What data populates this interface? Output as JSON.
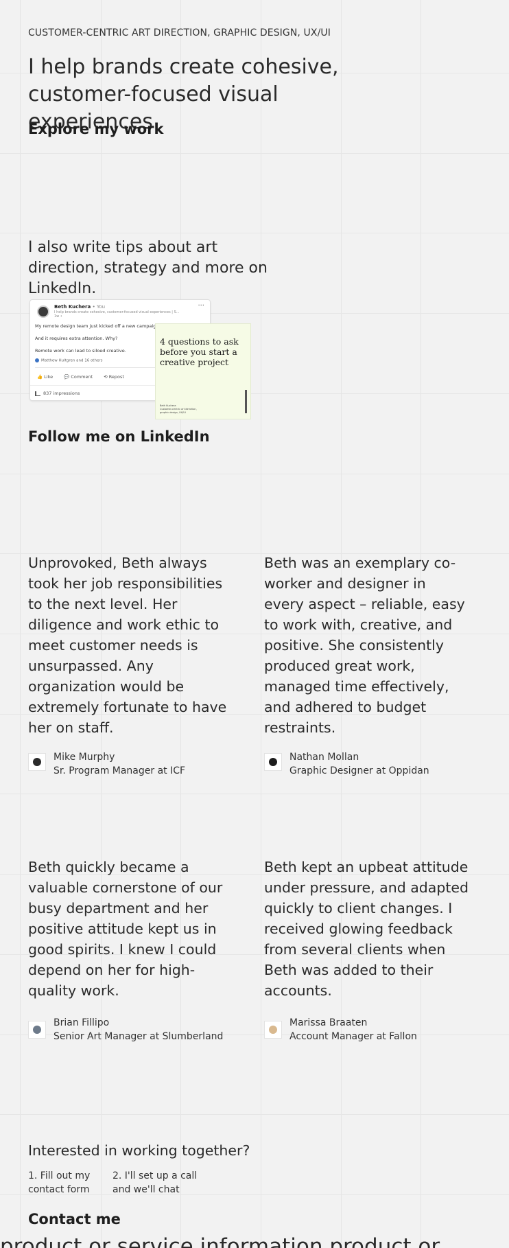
{
  "hero": {
    "eyebrow": "CUSTOMER-CENTRIC ART DIRECTION, GRAPHIC DESIGN, UX/UI",
    "headline": "I help brands create cohesive, customer-focused visual experiences",
    "explore_link": "Explore my work"
  },
  "linkedin_section": {
    "intro": "I also write tips about art direction, strategy and more on LinkedIn.",
    "post": {
      "author": "Beth Kuchera",
      "you_label": "• You",
      "meta": "I help brands create cohesive, customer-focused visual experiences | S...",
      "time": "1w • ",
      "line1": "My remote design team just kicked off a new campaign!",
      "line2": "And it requires extra attention. Why?",
      "line3": "Remote work can lead to siloed creative.",
      "reactions": "Matthew Hultgren and 16 others",
      "actions": [
        "Like",
        "Comment",
        "Repost"
      ],
      "impressions": "837 impressions",
      "more": "···"
    },
    "poster": {
      "title": "4 questions to ask before you start a creative project",
      "footer": "Beth Kuchera\nCustomer-centric art direction,\ngraphic design, UX/UI"
    },
    "follow_link": "Follow me on LinkedIn"
  },
  "testimonials": [
    {
      "quote": "Unprovoked, Beth always took her job responsibilities to the next level. Her diligence and work ethic to meet customer needs is unsurpassed. Any organization would be extremely fortunate to have her on staff.",
      "name": "Mike Murphy",
      "title": "Sr. Program Manager at ICF"
    },
    {
      "quote": "Beth was an exemplary co-worker and designer in every aspect – reliable, easy to work with, creative, and positive. She consistently produced great work, managed time effectively, and adhered to budget restraints.",
      "name": "Nathan Mollan",
      "title": "Graphic Designer at Oppidan"
    },
    {
      "quote": "Beth quickly became a valuable cornerstone of our busy department and her positive attitude kept us in good spirits. I knew I could depend on her for high-quality work.",
      "name": "Brian Fillipo",
      "title": "Senior Art Manager at Slumberland"
    },
    {
      "quote": "Beth kept an upbeat attitude under pressure, and adapted quickly to client changes. I received glowing feedback from several clients when Beth was added to their accounts.",
      "name": "Marissa Braaten",
      "title": "Account Manager at Fallon"
    }
  ],
  "contact_section": {
    "heading": "Interested in working together?",
    "step1": "1. Fill out my contact form",
    "step2": "2. I'll set up a call and we'll chat",
    "contact_link": "Contact me",
    "ticker": "product or service information product or"
  }
}
